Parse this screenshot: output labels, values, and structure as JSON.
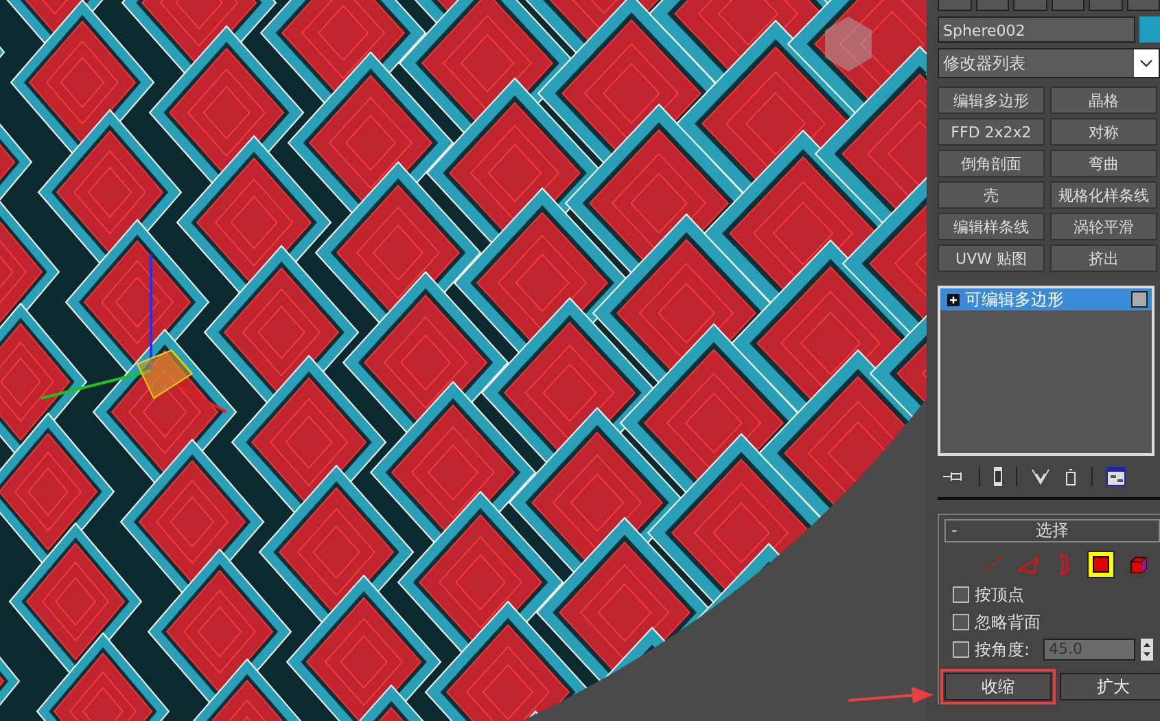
{
  "command_panel": {
    "object_name": "Sphere002",
    "modifier_list": {
      "placeholder": "修改器列表"
    },
    "modifier_buttons": [
      "编辑多边形",
      "晶格",
      "FFD 2x2x2",
      "对称",
      "倒角剖面",
      "弯曲",
      "壳",
      "规格化样条线",
      "编辑样条线",
      "涡轮平滑",
      "UVW 贴图",
      "挤出"
    ],
    "stack": [
      {
        "label": "可编辑多边形",
        "selected": true,
        "expanded": false
      }
    ],
    "selection_rollout": {
      "title": "选择",
      "collapse_sign": "-",
      "levels": [
        {
          "kind": "vertex",
          "selected": false
        },
        {
          "kind": "edge",
          "selected": false
        },
        {
          "kind": "border",
          "selected": false
        },
        {
          "kind": "polygon",
          "selected": true
        },
        {
          "kind": "element",
          "selected": false
        }
      ],
      "options": [
        {
          "label": "按顶点",
          "checked": false
        },
        {
          "label": "忽略背面",
          "checked": false
        },
        {
          "label": "按角度:",
          "checked": false,
          "value": "45.0"
        }
      ],
      "buttons": [
        {
          "label": "收缩",
          "highlighted": true
        },
        {
          "label": "扩大",
          "highlighted": false
        }
      ]
    }
  }
}
